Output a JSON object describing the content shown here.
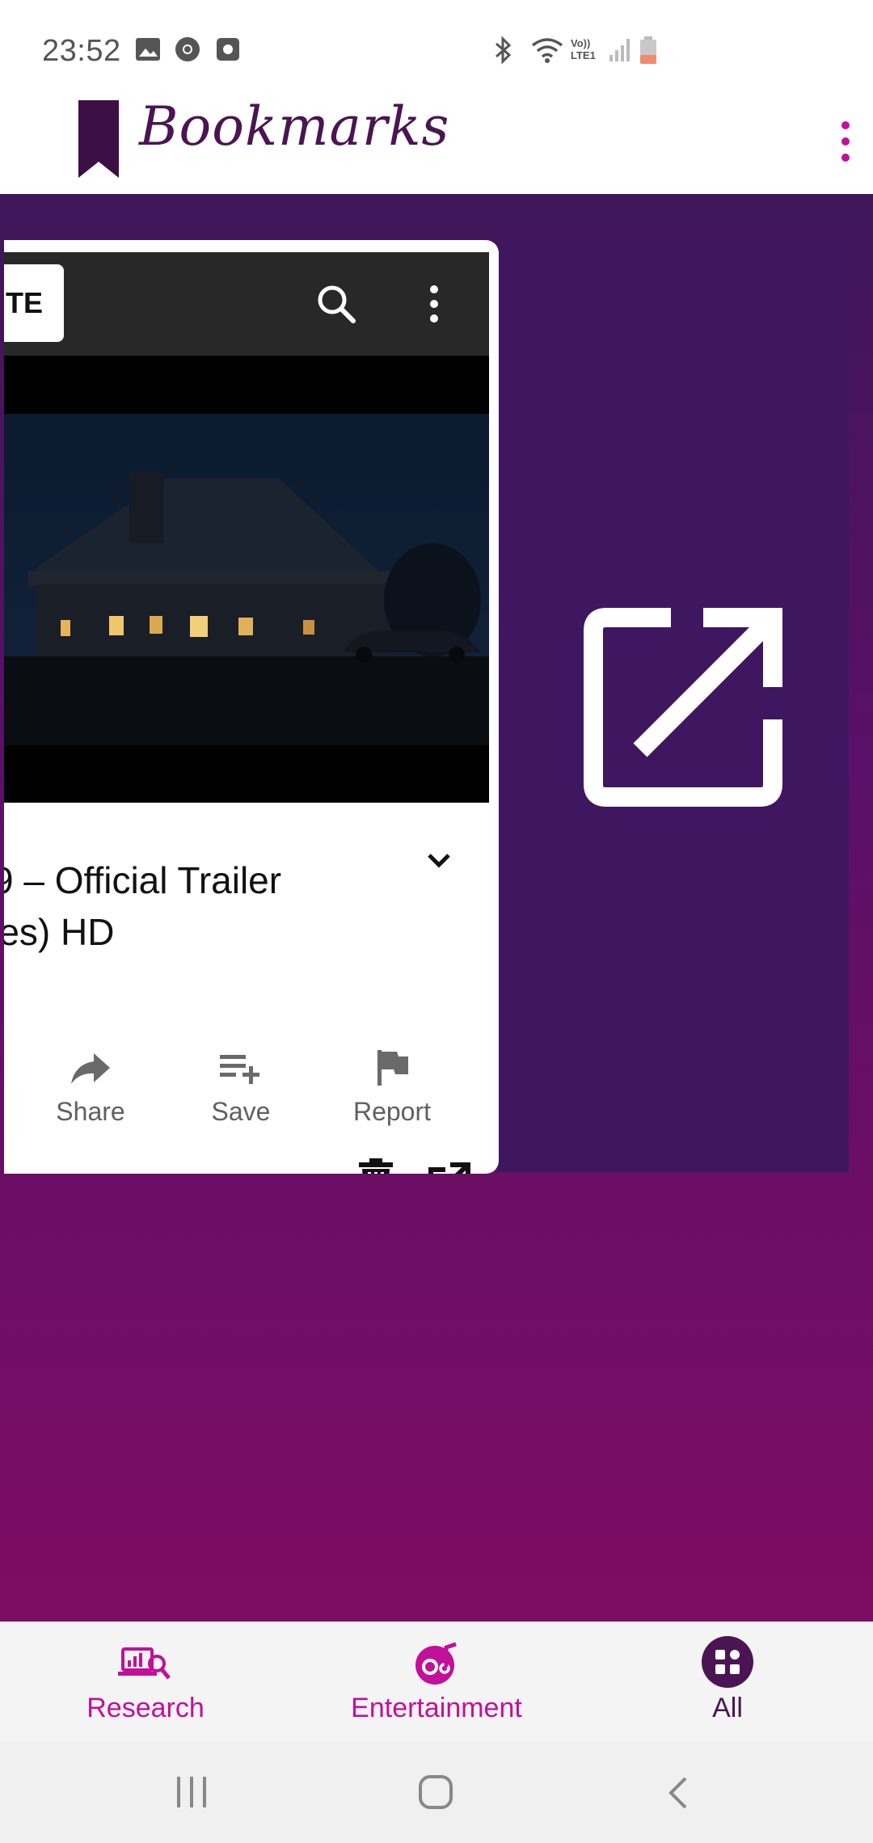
{
  "status_bar": {
    "time": "23:52",
    "network_label": "Vo)) LTE1"
  },
  "app": {
    "brand_name": "Bookmarks",
    "accent": "#c2109a",
    "brand_color": "#4a1552"
  },
  "card": {
    "badge_text": "TE",
    "title_line1": "9 – Official Trailer",
    "title_line2": "res) HD",
    "actions": [
      {
        "label": "Share",
        "icon": "share-icon"
      },
      {
        "label": "Save",
        "icon": "playlist-add-icon"
      },
      {
        "label": "Report",
        "icon": "flag-icon"
      }
    ]
  },
  "bottom_nav": {
    "items": [
      {
        "label": "Research",
        "icon": "research-icon",
        "selected": false
      },
      {
        "label": "Entertainment",
        "icon": "music-icon",
        "selected": false
      },
      {
        "label": "All",
        "icon": "grid-icon",
        "selected": true
      }
    ]
  }
}
